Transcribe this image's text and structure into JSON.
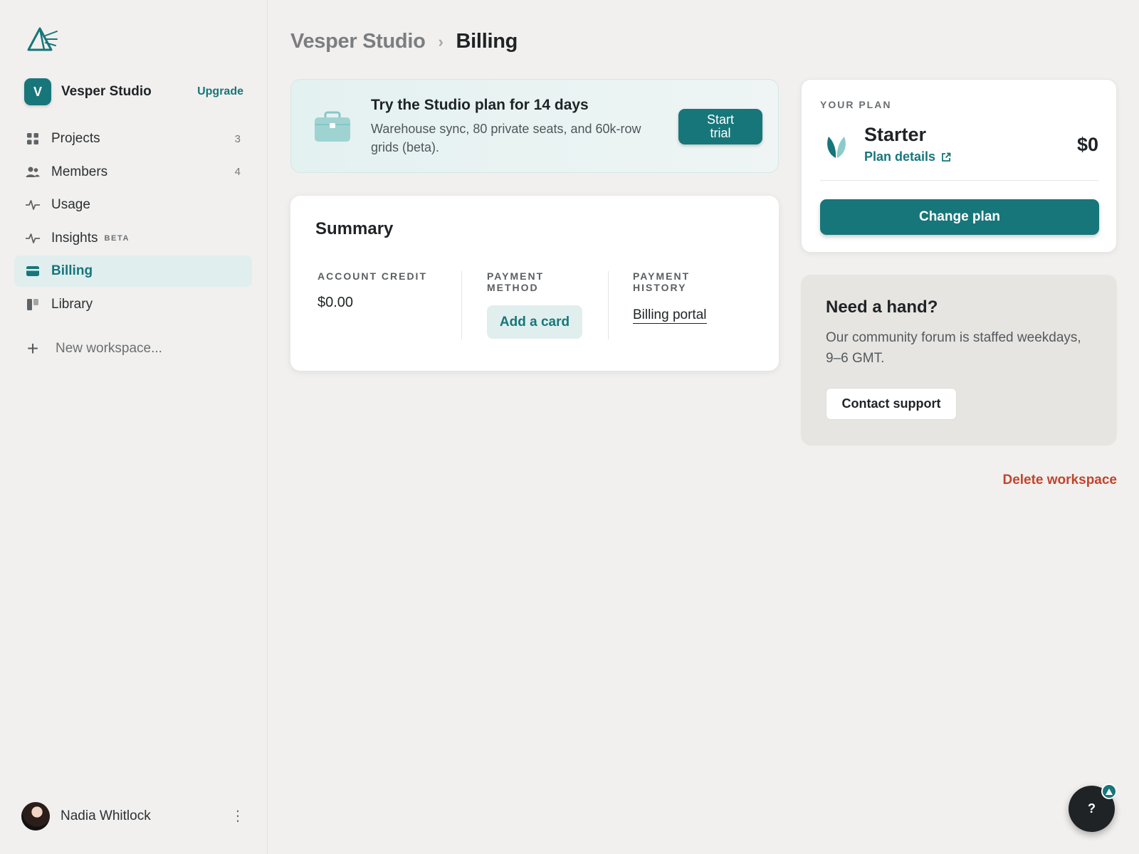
{
  "colors": {
    "accent": "#17767a",
    "danger": "#c0452e",
    "background": "#f1f0ee"
  },
  "sidebar": {
    "workspace": {
      "initial": "V",
      "name": "Vesper Studio",
      "upgrade_label": "Upgrade"
    },
    "items": [
      {
        "label": "Projects",
        "count": "3",
        "icon": "grid-icon"
      },
      {
        "label": "Members",
        "count": "4",
        "icon": "people-icon"
      },
      {
        "label": "Usage",
        "count": "",
        "icon": "pulse-icon"
      },
      {
        "label": "Insights",
        "badge": "BETA",
        "icon": "pulse-icon"
      },
      {
        "label": "Billing",
        "active": true,
        "icon": "card-icon"
      },
      {
        "label": "Library",
        "icon": "library-icon"
      }
    ],
    "new_workspace_label": "New workspace...",
    "user": {
      "name": "Nadia Whitlock"
    }
  },
  "header": {
    "breadcrumb_parent": "Vesper Studio",
    "breadcrumb_current": "Billing"
  },
  "trial_banner": {
    "title": "Try the Studio plan for 14 days",
    "text": "Warehouse sync, 80 private seats, and 60k-row grids (beta).",
    "button_line1": "Start",
    "button_line2": "trial"
  },
  "summary": {
    "title": "Summary",
    "account_credit_label": "ACCOUNT CREDIT",
    "account_credit_value": "$0.00",
    "payment_method_label_1": "PAYMENT",
    "payment_method_label_2": "METHOD",
    "add_card_label": "Add a card",
    "payment_history_label_1": "PAYMENT",
    "payment_history_label_2": "HISTORY",
    "billing_portal_label": "Billing portal"
  },
  "plan": {
    "label": "YOUR PLAN",
    "name": "Starter",
    "details_label": "Plan details",
    "price": "$0",
    "change_label": "Change plan"
  },
  "help": {
    "title": "Need a hand?",
    "text": "Our community forum is staffed weekdays, 9–6 GMT.",
    "contact_label": "Contact support"
  },
  "delete_workspace_label": "Delete workspace",
  "help_fab_label": "?"
}
